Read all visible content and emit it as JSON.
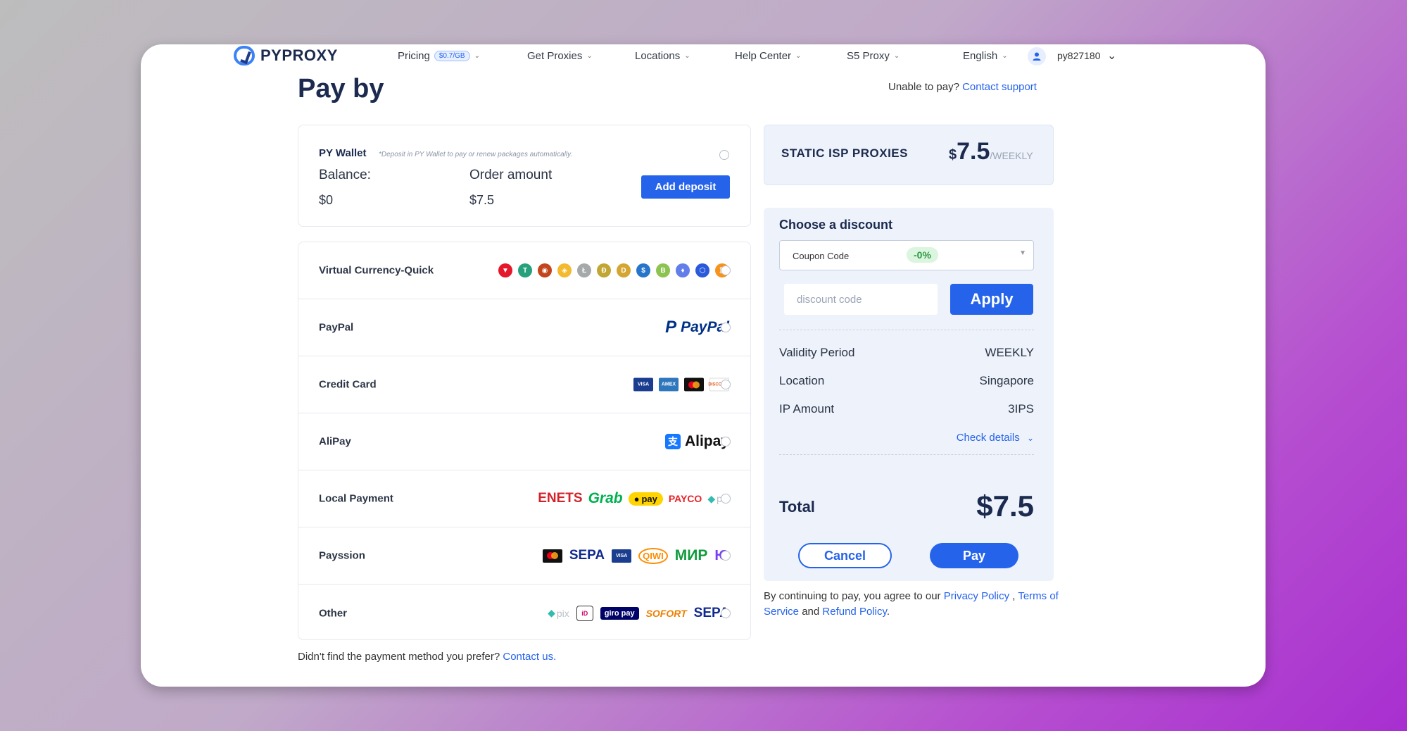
{
  "nav": {
    "logo_text": "PYPROXY",
    "pricing": "Pricing",
    "pricing_badge": "$0.7/GB",
    "get_proxies": "Get Proxies",
    "locations": "Locations",
    "help_center": "Help Center",
    "s5_proxy": "S5 Proxy",
    "language": "English",
    "username": "py827180"
  },
  "page_title": "Pay by",
  "support": {
    "text": "Unable to pay?",
    "link": "Contact support"
  },
  "wallet": {
    "title": "PY Wallet",
    "note": "*Deposit in PY Wallet to pay or renew packages automatically.",
    "balance_label": "Balance:",
    "balance_value": "$0",
    "order_label": "Order amount",
    "order_value": "$7.5",
    "deposit_button": "Add deposit"
  },
  "methods": [
    {
      "label": "Virtual Currency-Quick"
    },
    {
      "label": "PayPal"
    },
    {
      "label": "Credit Card"
    },
    {
      "label": "AliPay"
    },
    {
      "label": "Local Payment"
    },
    {
      "label": "Payssion"
    },
    {
      "label": "Other"
    }
  ],
  "coins": [
    {
      "name": "tron-icon",
      "color": "#e4172b",
      "glyph": "▼"
    },
    {
      "name": "tether-icon",
      "color": "#26a17b",
      "glyph": "T"
    },
    {
      "name": "shiba-icon",
      "color": "#c2451c",
      "glyph": "◉"
    },
    {
      "name": "bnb-icon",
      "color": "#f3ba2f",
      "glyph": "◈"
    },
    {
      "name": "litecoin-icon",
      "color": "#a6a9aa",
      "glyph": "Ł"
    },
    {
      "name": "dogecoin-icon",
      "color": "#c2a633",
      "glyph": "Ð"
    },
    {
      "name": "doge-gold-icon",
      "color": "#d4a531",
      "glyph": "D"
    },
    {
      "name": "usdc-icon",
      "color": "#2775ca",
      "glyph": "$"
    },
    {
      "name": "bitcoin-cash-icon",
      "color": "#8dc351",
      "glyph": "B"
    },
    {
      "name": "ethereum-icon",
      "color": "#627eea",
      "glyph": "♦"
    },
    {
      "name": "chainlink-icon",
      "color": "#2a5ada",
      "glyph": "⬡"
    },
    {
      "name": "bitcoin-icon",
      "color": "#f7931a",
      "glyph": "₿"
    }
  ],
  "brands": {
    "paypal": "PayPal",
    "alipay": "Alipay",
    "enets": "ENETS",
    "grab": "Grab",
    "pay": "pay",
    "payco": "PAYCO",
    "pix": "pix",
    "sepa": "SEPA",
    "qiwi": "QIWI",
    "mir": "МИР",
    "giropay": "giro pay",
    "sofort": "SOFORT"
  },
  "not_found": {
    "text": "Didn't find the payment method you prefer?",
    "link": "Contact us."
  },
  "product": {
    "name": "STATIC ISP PROXIES",
    "currency": "$",
    "amount": "7.5",
    "period": "/WEEKLY"
  },
  "discount": {
    "title": "Choose a discount",
    "coupon_label": "Coupon Code",
    "coupon_pct": "-0%",
    "code_placeholder": "discount code",
    "apply": "Apply",
    "rows": [
      {
        "label": "Validity Period",
        "value": "WEEKLY"
      },
      {
        "label": "Location",
        "value": "Singapore"
      },
      {
        "label": "IP Amount",
        "value": "3IPS"
      }
    ],
    "check_details": "Check details",
    "total_label": "Total",
    "total_value": "$7.5",
    "cancel": "Cancel",
    "pay": "Pay"
  },
  "legal": {
    "prefix": "By continuing to pay, you agree to our",
    "privacy": "Privacy Policy",
    "comma": ",",
    "terms": "Terms of Service",
    "and": "and",
    "refund": "Refund Policy",
    "period": "."
  },
  "colors": {
    "accent": "#2563eb",
    "title": "#1b2a4e",
    "panel": "#eef3fb",
    "discount_green": "#2d9a44"
  }
}
